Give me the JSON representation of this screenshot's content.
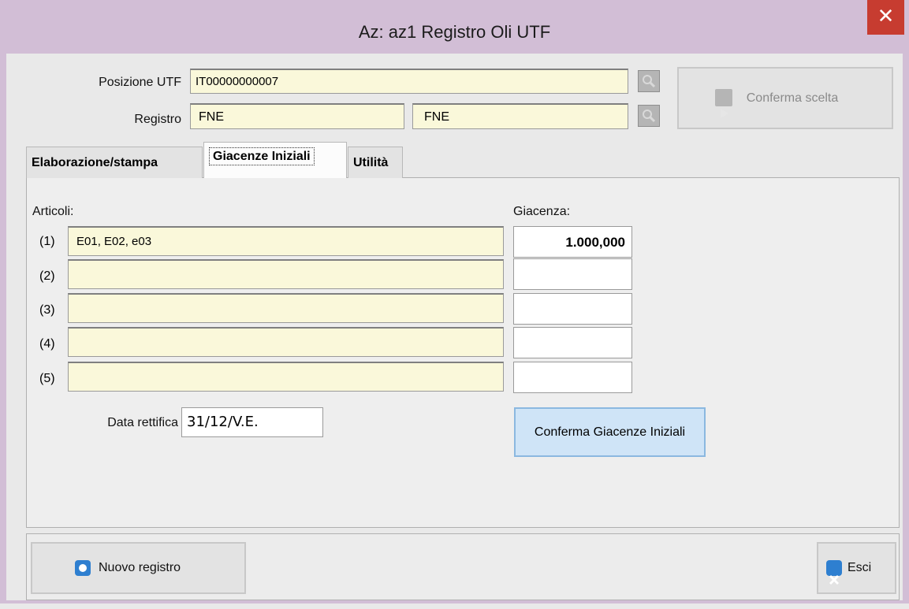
{
  "window": {
    "title": "Az: az1   Registro Oli UTF",
    "close_symbol": "✕"
  },
  "header": {
    "posizione_label": "Posizione UTF",
    "posizione_value": "IT00000000007",
    "registro_label": "Registro",
    "registro_code": "FNE",
    "registro_desc": "FNE",
    "conferma_scelta_label": "Conferma scelta"
  },
  "tabs": [
    {
      "label": "Elaborazione/stampa"
    },
    {
      "label": "Giacenze Iniziali"
    },
    {
      "label": "Utilità"
    }
  ],
  "giacenze": {
    "articoli_label": "Articoli:",
    "giacenza_label": "Giacenza:",
    "rows": [
      {
        "num": "(1)",
        "articoli": "E01,  E02,  e03",
        "giacenza": "1.000,000"
      },
      {
        "num": "(2)",
        "articoli": "",
        "giacenza": ""
      },
      {
        "num": "(3)",
        "articoli": "",
        "giacenza": ""
      },
      {
        "num": "(4)",
        "articoli": "",
        "giacenza": ""
      },
      {
        "num": "(5)",
        "articoli": "",
        "giacenza": ""
      }
    ],
    "data_rettifica_label": "Data rettifica",
    "data_rettifica_value": "31/12/V.E.",
    "conferma_button": "Conferma Giacenze Iniziali"
  },
  "footer": {
    "nuovo_registro": "Nuovo registro",
    "esci": "Esci"
  },
  "colors": {
    "titlebar": "#d2bed6",
    "field_bg": "#faf8da",
    "close_bg": "#c73c30",
    "accent_button": "#cfe4f7"
  },
  "icons": {
    "search": "search-icon",
    "conferma": "play-icon",
    "nuovo": "new-icon",
    "esci": "exit-icon"
  }
}
